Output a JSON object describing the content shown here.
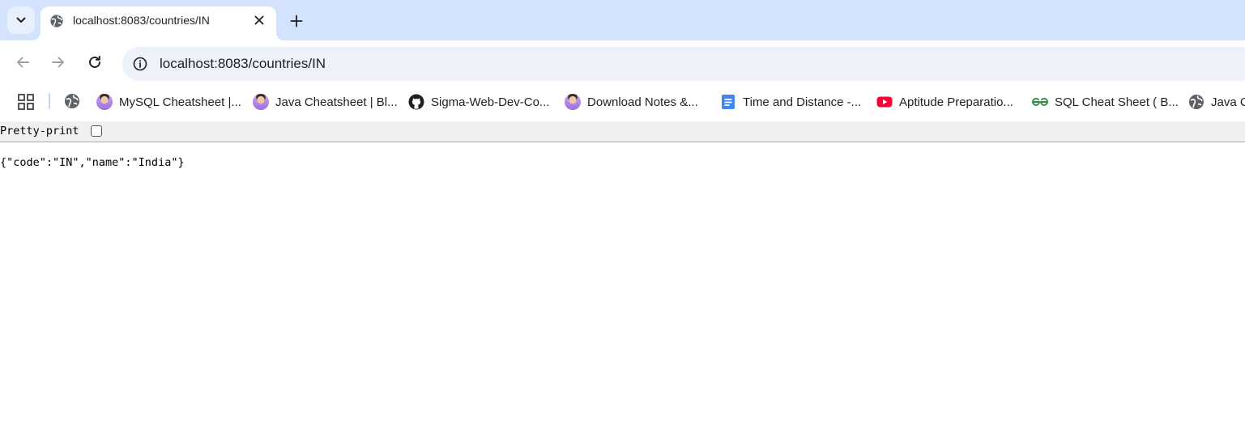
{
  "browser": {
    "tab": {
      "title": "localhost:8083/countries/IN"
    },
    "omnibox": {
      "url": "localhost:8083/countries/IN"
    },
    "bookmarks": [
      {
        "label": "MySQL Cheatsheet |...",
        "icon": "avatar-icon"
      },
      {
        "label": "Java Cheatsheet | Bl...",
        "icon": "avatar-icon"
      },
      {
        "label": "Sigma-Web-Dev-Co...",
        "icon": "github-icon"
      },
      {
        "label": "Download Notes &...",
        "icon": "avatar-icon"
      },
      {
        "label": "Time and Distance -...",
        "icon": "google-docs-icon"
      },
      {
        "label": "Aptitude Preparatio...",
        "icon": "youtube-icon"
      },
      {
        "label": "SQL Cheat Sheet ( B...",
        "icon": "geeksforgeeks-icon"
      },
      {
        "label": "Java C",
        "icon": "globe-icon"
      }
    ]
  },
  "viewer": {
    "pretty_print_label": "Pretty-print",
    "pretty_print_checked": false,
    "json_text": "{\"code\":\"IN\",\"name\":\"India\"}"
  },
  "colors": {
    "tabstrip_bg": "#d3e3fd",
    "omnibox_bg": "#edf1fa",
    "youtube_red": "#ff0033",
    "docs_blue": "#4285f4",
    "gfg_green": "#2f8d46"
  }
}
